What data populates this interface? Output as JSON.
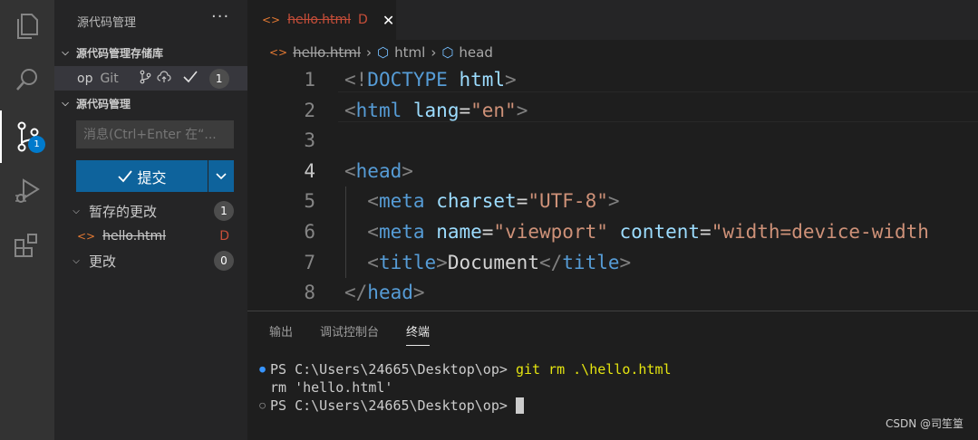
{
  "activity_bar": {
    "items": [
      "explorer-icon",
      "search-icon",
      "source-control-icon",
      "run-debug-icon",
      "extensions-icon"
    ],
    "source_control_badge": "1",
    "accent_color": "#007acc"
  },
  "sidebar": {
    "title": "源代码管理",
    "more_label": "···",
    "repositories_header": "源代码管理存储库",
    "repo": {
      "name": "op",
      "provider": "Git",
      "count": "1"
    },
    "scm_header": "源代码管理",
    "message_placeholder": "消息(Ctrl+Enter 在“...",
    "commit_label": "提交",
    "staged_group": {
      "label": "暂存的更改",
      "count": "1"
    },
    "staged_file": {
      "name": "hello.html",
      "status": "D"
    },
    "changes_group": {
      "label": "更改",
      "count": "0"
    }
  },
  "editor": {
    "tab": {
      "name": "hello.html",
      "status": "D"
    },
    "breadcrumb": [
      "hello.html",
      "html",
      "head"
    ],
    "lines": [
      {
        "n": "1",
        "parts": [
          [
            "p",
            "<!"
          ],
          [
            "t",
            "DOCTYPE"
          ],
          [
            "w",
            " "
          ],
          [
            "a",
            "html"
          ],
          [
            "p",
            ">"
          ]
        ]
      },
      {
        "n": "2",
        "parts": [
          [
            "p",
            "<"
          ],
          [
            "t",
            "html"
          ],
          [
            "w",
            " "
          ],
          [
            "a",
            "lang"
          ],
          [
            "w",
            "="
          ],
          [
            "s",
            "\"en\""
          ],
          [
            "p",
            ">"
          ]
        ]
      },
      {
        "n": "3",
        "parts": []
      },
      {
        "n": "4",
        "parts": [
          [
            "p",
            "<"
          ],
          [
            "t",
            "head"
          ],
          [
            "p",
            ">"
          ]
        ]
      },
      {
        "n": "5",
        "parts": [
          [
            "w",
            "  "
          ],
          [
            "p",
            "<"
          ],
          [
            "t",
            "meta"
          ],
          [
            "w",
            " "
          ],
          [
            "a",
            "charset"
          ],
          [
            "w",
            "="
          ],
          [
            "s",
            "\"UTF-8\""
          ],
          [
            "p",
            ">"
          ]
        ]
      },
      {
        "n": "6",
        "parts": [
          [
            "w",
            "  "
          ],
          [
            "p",
            "<"
          ],
          [
            "t",
            "meta"
          ],
          [
            "w",
            " "
          ],
          [
            "a",
            "name"
          ],
          [
            "w",
            "="
          ],
          [
            "s",
            "\"viewport\""
          ],
          [
            "w",
            " "
          ],
          [
            "a",
            "content"
          ],
          [
            "w",
            "="
          ],
          [
            "s",
            "\"width=device-width"
          ]
        ]
      },
      {
        "n": "7",
        "parts": [
          [
            "w",
            "  "
          ],
          [
            "p",
            "<"
          ],
          [
            "t",
            "title"
          ],
          [
            "p",
            ">"
          ],
          [
            "w",
            "Document"
          ],
          [
            "p",
            "</"
          ],
          [
            "t",
            "title"
          ],
          [
            "p",
            ">"
          ]
        ]
      },
      {
        "n": "8",
        "parts": [
          [
            "p",
            "</"
          ],
          [
            "t",
            "head"
          ],
          [
            "p",
            ">"
          ]
        ]
      }
    ]
  },
  "panel": {
    "tabs": [
      "输出",
      "调试控制台",
      "终端"
    ],
    "active_tab": "终端",
    "terminal": [
      {
        "marker": "●",
        "marker_color": "#3794ff",
        "prompt": "PS C:\\Users\\24665\\Desktop\\op> ",
        "command": "git rm .\\hello.html"
      },
      {
        "marker": "",
        "marker_color": "",
        "prompt": "rm 'hello.html'",
        "command": ""
      },
      {
        "marker": "○",
        "marker_color": "#8b8b8b",
        "prompt": "PS C:\\Users\\24665\\Desktop\\op> ",
        "command": ""
      }
    ]
  },
  "watermark": "CSDN @司笙篁"
}
